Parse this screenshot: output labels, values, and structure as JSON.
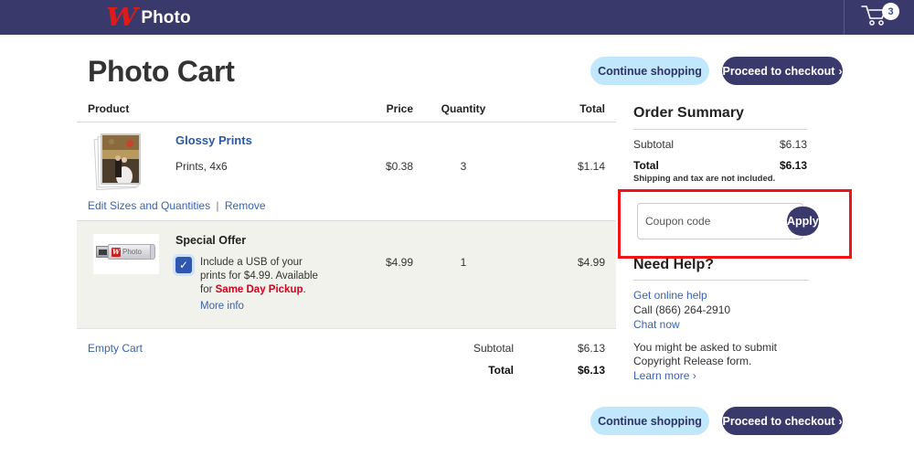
{
  "header": {
    "brand_mark": "W",
    "brand_name": "Photo",
    "cart_count": "3",
    "cart_icon": "shopping-cart-icon"
  },
  "page": {
    "title": "Photo Cart",
    "continue_shopping": "Continue shopping",
    "proceed_to_checkout": "Proceed to checkout",
    "chevron": "›"
  },
  "table": {
    "headers": {
      "product": "Product",
      "price": "Price",
      "quantity": "Quantity",
      "total": "Total"
    },
    "items": [
      {
        "name": "Glossy Prints",
        "description": "Prints, 4x6",
        "price": "$0.38",
        "quantity": "3",
        "total": "$1.14",
        "edit_link": "Edit Sizes and Quantities",
        "separator": "|",
        "remove_link": "Remove",
        "thumbnail": "glossy-prints-photo-stack"
      }
    ],
    "offer": {
      "heading": "Special Offer",
      "text_before": "Include a USB of your prints for $4.99. Available for ",
      "highlight": "Same Day Pickup",
      "text_after": ".",
      "more_info": "More info",
      "checked": true,
      "checkmark": "✓",
      "price": "$4.99",
      "quantity": "1",
      "total": "$4.99",
      "usb_badge": "W",
      "usb_label": "Photo"
    },
    "footer": {
      "empty_cart": "Empty Cart",
      "subtotal_label": "Subtotal",
      "subtotal_value": "$6.13",
      "total_label": "Total",
      "total_value": "$6.13"
    }
  },
  "order_summary": {
    "heading": "Order Summary",
    "subtotal_label": "Subtotal",
    "subtotal_value": "$6.13",
    "total_label": "Total",
    "total_value": "$6.13",
    "note": "Shipping and tax are not included."
  },
  "coupon": {
    "placeholder": "Coupon code",
    "value": "",
    "apply_label": "Apply",
    "highlight_color": "#f21414"
  },
  "help": {
    "heading": "Need Help?",
    "online_help": "Get online help",
    "phone": "Call (866) 264-2910",
    "chat": "Chat now",
    "copyright_note": "You might be asked to submit Copyright Release form.",
    "learn_more": "Learn more ›"
  },
  "colors": {
    "brand_navy": "#393a6b",
    "brand_red": "#e01a1a",
    "light_blue": "#c0e7fb",
    "link_blue": "#3a63ad",
    "offer_bg": "#f2f2ec"
  }
}
